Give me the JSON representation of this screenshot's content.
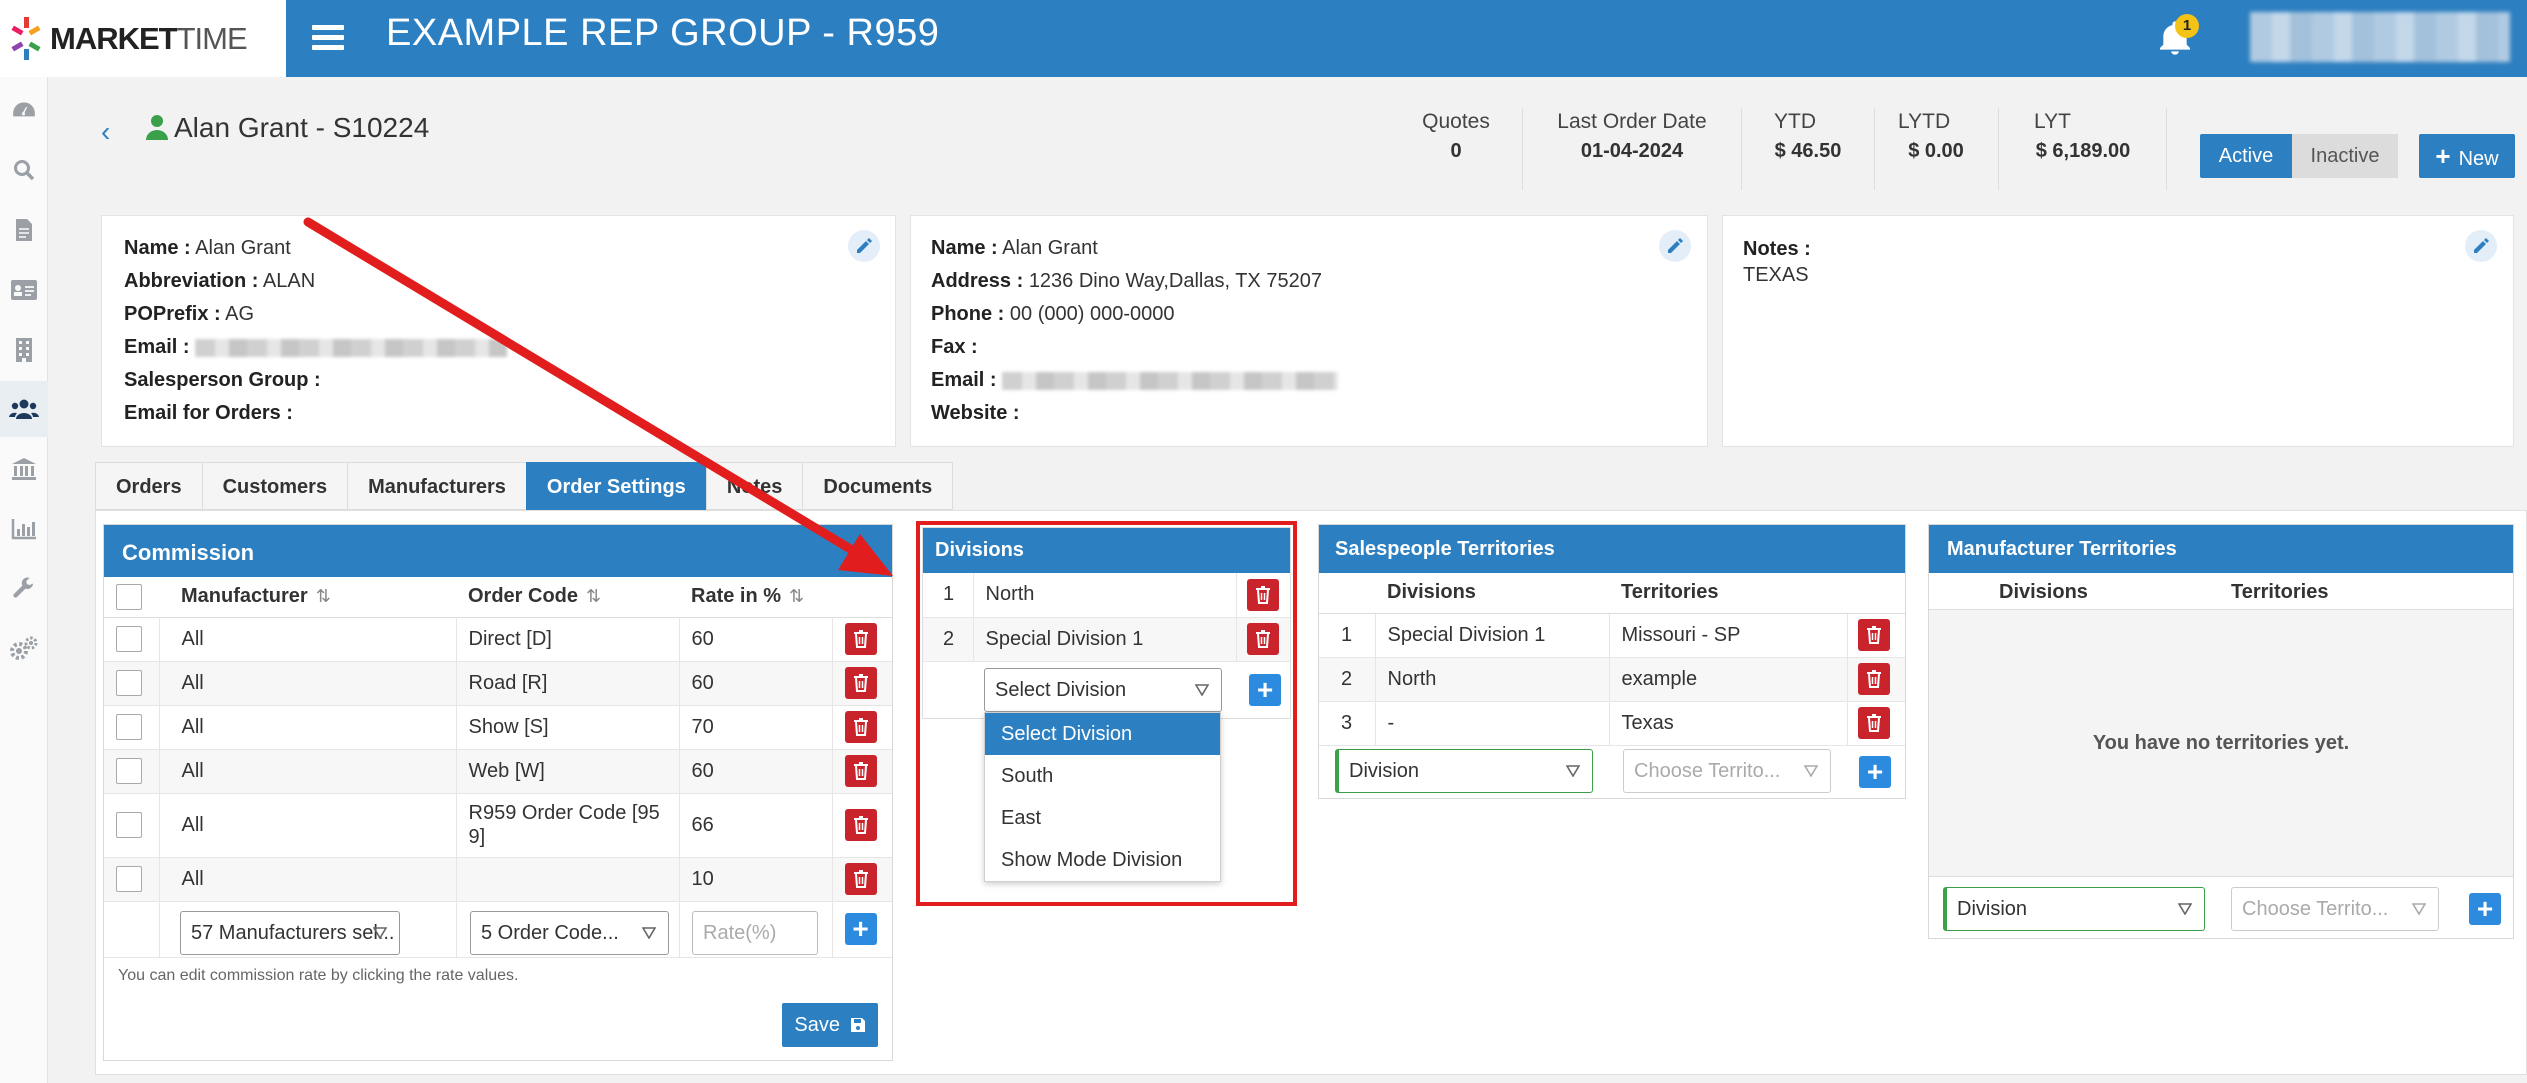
{
  "app": {
    "logo_bold": "MARKET",
    "logo_light": "TIME",
    "title": "EXAMPLE REP GROUP - R959",
    "notification_count": "1"
  },
  "sidebar": {
    "icons": [
      "dashboard-icon",
      "search-icon",
      "document-icon",
      "contact-card-icon",
      "building-icon",
      "users-icon",
      "bank-icon",
      "chart-icon",
      "wrench-icon",
      "settings-icon"
    ],
    "active": "users-icon"
  },
  "header": {
    "title": "Alan Grant - S10224",
    "stats": [
      {
        "label": "Quotes",
        "value": "0"
      },
      {
        "label": "Last Order Date",
        "value": "01-04-2024"
      },
      {
        "label": "YTD",
        "value": "$ 46.50"
      },
      {
        "label": "LYTD",
        "value": "$ 0.00"
      },
      {
        "label": "LYT",
        "value": "$ 6,189.00"
      }
    ],
    "active_label": "Active",
    "inactive_label": "Inactive",
    "new_label": "New"
  },
  "card1": {
    "name_label": "Name :",
    "name": "Alan Grant",
    "abbr_label": "Abbreviation :",
    "abbr": "ALAN",
    "poprefix_label": "POPrefix :",
    "poprefix": "AG",
    "email_label": "Email :",
    "group_label": "Salesperson Group :",
    "orders_email_label": "Email for Orders :"
  },
  "card2": {
    "name_label": "Name :",
    "name": "Alan Grant",
    "address_label": "Address :",
    "address": "1236 Dino Way,Dallas, TX 75207",
    "phone_label": "Phone :",
    "phone": "00 (000) 000-0000",
    "fax_label": "Fax :",
    "email_label": "Email :",
    "website_label": "Website :"
  },
  "card3": {
    "notes_label": "Notes :",
    "notes": "TEXAS"
  },
  "tabs": [
    "Orders",
    "Customers",
    "Manufacturers",
    "Order Settings",
    "Notes",
    "Documents"
  ],
  "active_tab": "Order Settings",
  "commission": {
    "title": "Commission",
    "headers": [
      "Manufacturer",
      "Order Code",
      "Rate in %"
    ],
    "rows": [
      {
        "manufacturer": "All",
        "order_code": "Direct [D]",
        "rate": "60"
      },
      {
        "manufacturer": "All",
        "order_code": "Road [R]",
        "rate": "60"
      },
      {
        "manufacturer": "All",
        "order_code": "Show [S]",
        "rate": "70"
      },
      {
        "manufacturer": "All",
        "order_code": "Web [W]",
        "rate": "60"
      },
      {
        "manufacturer": "All",
        "order_code_line1": "R959 Order Code [95",
        "order_code_line2": "9]",
        "rate": "66"
      },
      {
        "manufacturer": "All",
        "order_code": "",
        "rate": "10"
      }
    ],
    "manufacturer_select": "57 Manufacturers sel...",
    "order_code_select": "5 Order Code...",
    "rate_placeholder": "Rate(%)",
    "hint": "You can edit commission rate by clicking the rate values.",
    "save_label": "Save"
  },
  "divisions": {
    "title": "Divisions",
    "rows": [
      {
        "num": "1",
        "name": "North"
      },
      {
        "num": "2",
        "name": "Special Division 1"
      }
    ],
    "select_value": "Select Division",
    "options": [
      "Select Division",
      "South",
      "East",
      "Show Mode Division"
    ]
  },
  "salespeople_territories": {
    "title": "Salespeople Territories",
    "headers": [
      "Divisions",
      "Territories"
    ],
    "rows": [
      {
        "num": "1",
        "division": "Special Division 1",
        "territory": "Missouri - SP"
      },
      {
        "num": "2",
        "division": "North",
        "territory": "example"
      },
      {
        "num": "3",
        "division": "-",
        "territory": "Texas"
      }
    ],
    "division_select": "Division",
    "territory_placeholder": "Choose Territo..."
  },
  "manufacturer_territories": {
    "title": "Manufacturer Territories",
    "headers": [
      "Divisions",
      "Territories"
    ],
    "empty": "You have no territories yet.",
    "division_select": "Division",
    "territory_placeholder": "Choose Territo..."
  },
  "colors": {
    "primary": "#2c7fc1",
    "danger": "#c9242b",
    "highlight": "#e21d1d",
    "success": "#3aa04a"
  }
}
